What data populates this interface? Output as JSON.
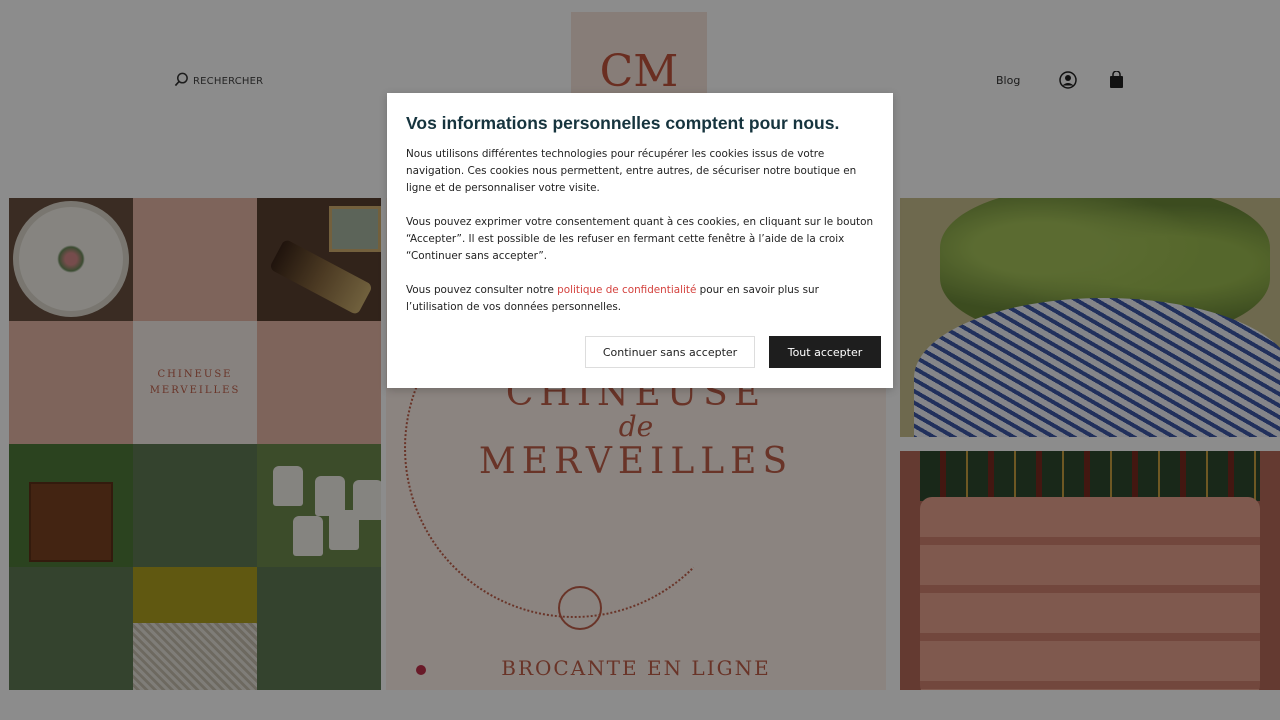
{
  "header": {
    "search_label": "RECHERCHER",
    "logo_monogram": "CM",
    "blog_label": "Blog"
  },
  "hero": {
    "tile_text_1": "CHINEUSE",
    "tile_text_2": "MERVEILLES",
    "banner_line_1": "CHINEUSE",
    "banner_line_de": "de",
    "banner_line_2": "MERVEILLES",
    "banner_line_3": "BROCANTE EN LIGNE"
  },
  "consent": {
    "title": "Vos informations personnelles comptent pour nous.",
    "para1": "Nous utilisons différentes technologies pour récupérer les cookies issus de votre navigation. Ces cookies nous permettent, entre autres, de sécuriser notre boutique en ligne et de personnaliser votre visite.",
    "para2": "Vous pouvez exprimer votre consentement quant à ces cookies, en cliquant sur le bouton “Accepter”. Il est possible de les refuser en fermant cette fenêtre à l’aide de la croix “Continuer sans accepter”.",
    "para3_before": "Vous pouvez consulter notre ",
    "para3_link": "politique de confidentialité",
    "para3_after": " pour en savoir plus sur l’utilisation de vos données personnelles.",
    "btn_decline": "Continuer sans accepter",
    "btn_accept": "Tout accepter"
  },
  "colors": {
    "brand": "#c0604a",
    "link": "#d4423e",
    "title": "#16343e",
    "accept_bg": "#1e1e1e"
  },
  "icons": {
    "search": "search-icon",
    "account": "user-icon",
    "cart": "shopping-bag-icon"
  }
}
